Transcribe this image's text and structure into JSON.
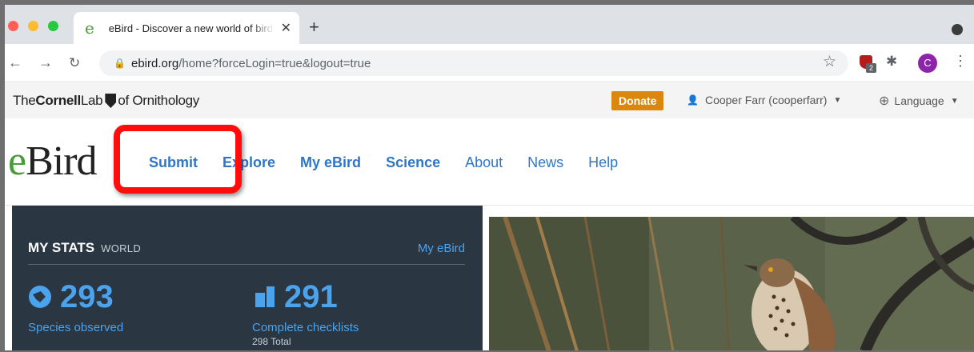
{
  "browser": {
    "tab_title": "eBird - Discover a new world of birds",
    "tab_favicon": "e",
    "url_host": "ebird.org",
    "url_path": "/home?forceLogin=true&logout=true",
    "extension_badge": "2",
    "profile_initial": "C"
  },
  "cornell_bar": {
    "logo_the": "The",
    "logo_cornell": "Cornell",
    "logo_lab": "Lab",
    "logo_of": "of Ornithology",
    "donate_label": "Donate",
    "user_label": "Cooper Farr (cooperfarr)",
    "language_label": "Language"
  },
  "site": {
    "logo_e": "e",
    "logo_rest": "Bird",
    "nav": {
      "submit": "Submit",
      "explore": "Explore",
      "my_ebird": "My eBird",
      "science": "Science",
      "about": "About",
      "news": "News",
      "help": "Help"
    }
  },
  "stats": {
    "title": "MY STATS",
    "region": "WORLD",
    "link": "My eBird",
    "species_value": "293",
    "species_label": "Species observed",
    "checklists_value": "291",
    "checklists_label": "Complete checklists",
    "checklists_total": "298 Total"
  },
  "colors": {
    "nav_blue": "#2e76c8",
    "donate": "#d9870f",
    "stats_bg": "#2a3642",
    "stats_accent": "#4aa3ec",
    "highlight": "#ff0d0d"
  }
}
